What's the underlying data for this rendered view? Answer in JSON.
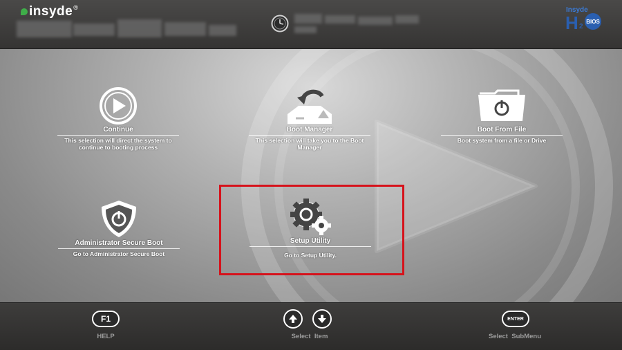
{
  "header": {
    "brand": "insyde",
    "brand_mark": "®",
    "bios_logo": {
      "line1": "Insyde",
      "line2": "BIOS"
    }
  },
  "tiles": [
    {
      "label": "Continue",
      "description": "This selection will direct the system to continue to booting process",
      "icon": "play-circle-icon"
    },
    {
      "label": "Boot Manager",
      "description": "This selection will take you to the Boot Manager",
      "icon": "boot-arrow-icon"
    },
    {
      "label": "Boot From File",
      "description": "Boot system from a file or Drive",
      "icon": "folder-power-icon"
    },
    {
      "label": "Administrator Secure Boot",
      "description": "Go to Administrator Secure Boot",
      "icon": "shield-power-icon"
    },
    {
      "label": "Setup Utility",
      "description": "Go to Setup Utility.",
      "icon": "gears-icon",
      "selected": true
    }
  ],
  "footer": {
    "help": {
      "key": "F1",
      "caption": "HELP"
    },
    "select_item": {
      "caption": "Select  Item"
    },
    "select_submenu": {
      "key": "ENTER",
      "caption": "Select  SubMenu"
    }
  },
  "colors": {
    "selection": "#d6121b",
    "brand_green": "#3fae49",
    "bios_blue": "#2a5fb0"
  }
}
